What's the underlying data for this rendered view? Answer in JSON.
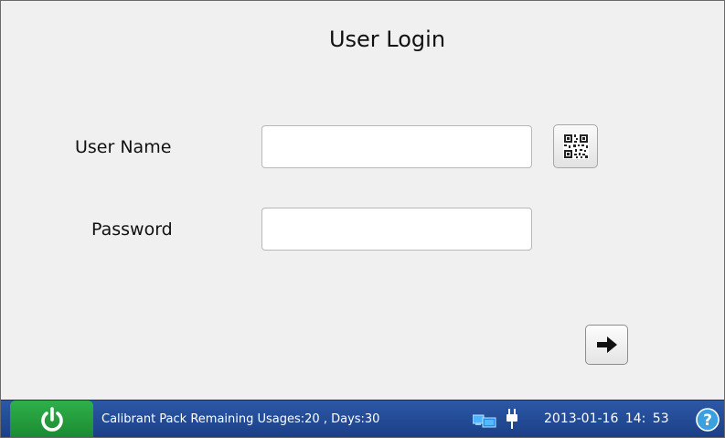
{
  "header": {
    "title": "User Login"
  },
  "form": {
    "username_label": "User Name",
    "username_value": "",
    "password_label": "Password",
    "password_value": ""
  },
  "icons": {
    "qr": "qr-code-icon",
    "next": "arrow-right-icon",
    "power": "power-icon",
    "network": "network-icon",
    "plug": "power-plug-icon",
    "help": "help-icon"
  },
  "status_bar": {
    "message": "Calibrant Pack Remaining Usages:20 , Days:30",
    "datetime": "2013-01-16 14: 53"
  },
  "colors": {
    "background": "#f0f0f0",
    "status_bar": "#1f4a95",
    "power_button": "#25a03f",
    "help_icon": "#3aa0e0"
  }
}
